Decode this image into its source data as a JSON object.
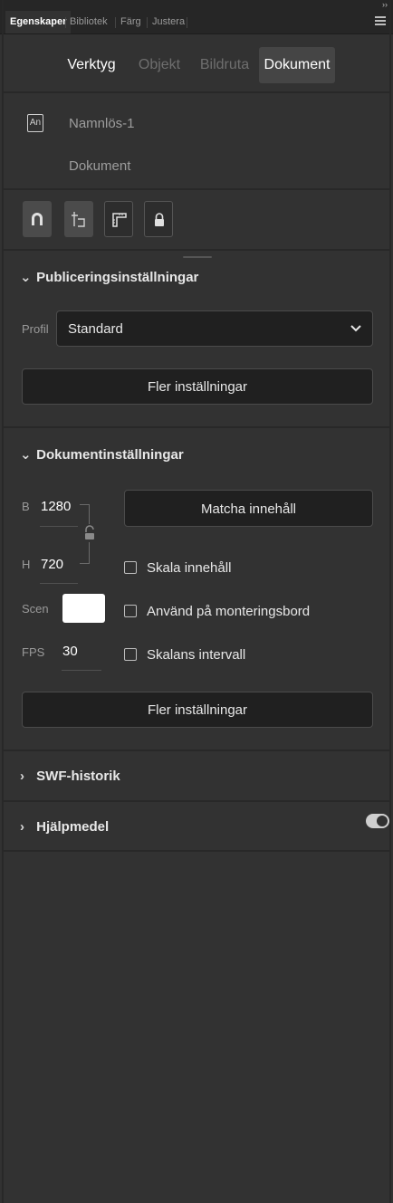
{
  "panel_tabs": [
    {
      "label": "Egenskaper",
      "active": true
    },
    {
      "label": "Bibliotek",
      "active": false
    },
    {
      "label": "Färg",
      "active": false
    },
    {
      "label": "Justera",
      "active": false
    }
  ],
  "mode_tabs": [
    "Verktyg",
    "Objekt",
    "Bildruta",
    "Dokument"
  ],
  "active_mode_tab": "Dokument",
  "document": {
    "icon_text": "An",
    "name": "Namnlös-1",
    "type": "Dokument"
  },
  "toolbar_icons": [
    "magnet-icon",
    "snap-icon",
    "ruler-icon",
    "lock-icon"
  ],
  "publish": {
    "title": "Publiceringsinställningar",
    "profile_label": "Profil",
    "profile_value": "Standard",
    "more_button": "Fler inställningar"
  },
  "docsettings": {
    "title": "Dokumentinställningar",
    "width_label": "B",
    "width_value": "1280",
    "height_label": "H",
    "height_value": "720",
    "stage_label": "Scen",
    "stage_color": "#ffffff",
    "fps_label": "FPS",
    "fps_value": "30",
    "match_button": "Matcha innehåll",
    "scale_content": "Skala innehåll",
    "apply_pasteboard": "Använd på monteringsbord",
    "scale_spans": "Skalans intervall",
    "more_button": "Fler inställningar"
  },
  "swf_history": {
    "title": "SWF-historik"
  },
  "accessibility": {
    "title": "Hjälpmedel",
    "toggle_on": true
  },
  "colors": {
    "panel_bg": "#323232",
    "field_bg": "#202020",
    "active_tab_bg": "#454545",
    "text": "#e8e8e8",
    "muted_text": "#9a9a9a"
  }
}
